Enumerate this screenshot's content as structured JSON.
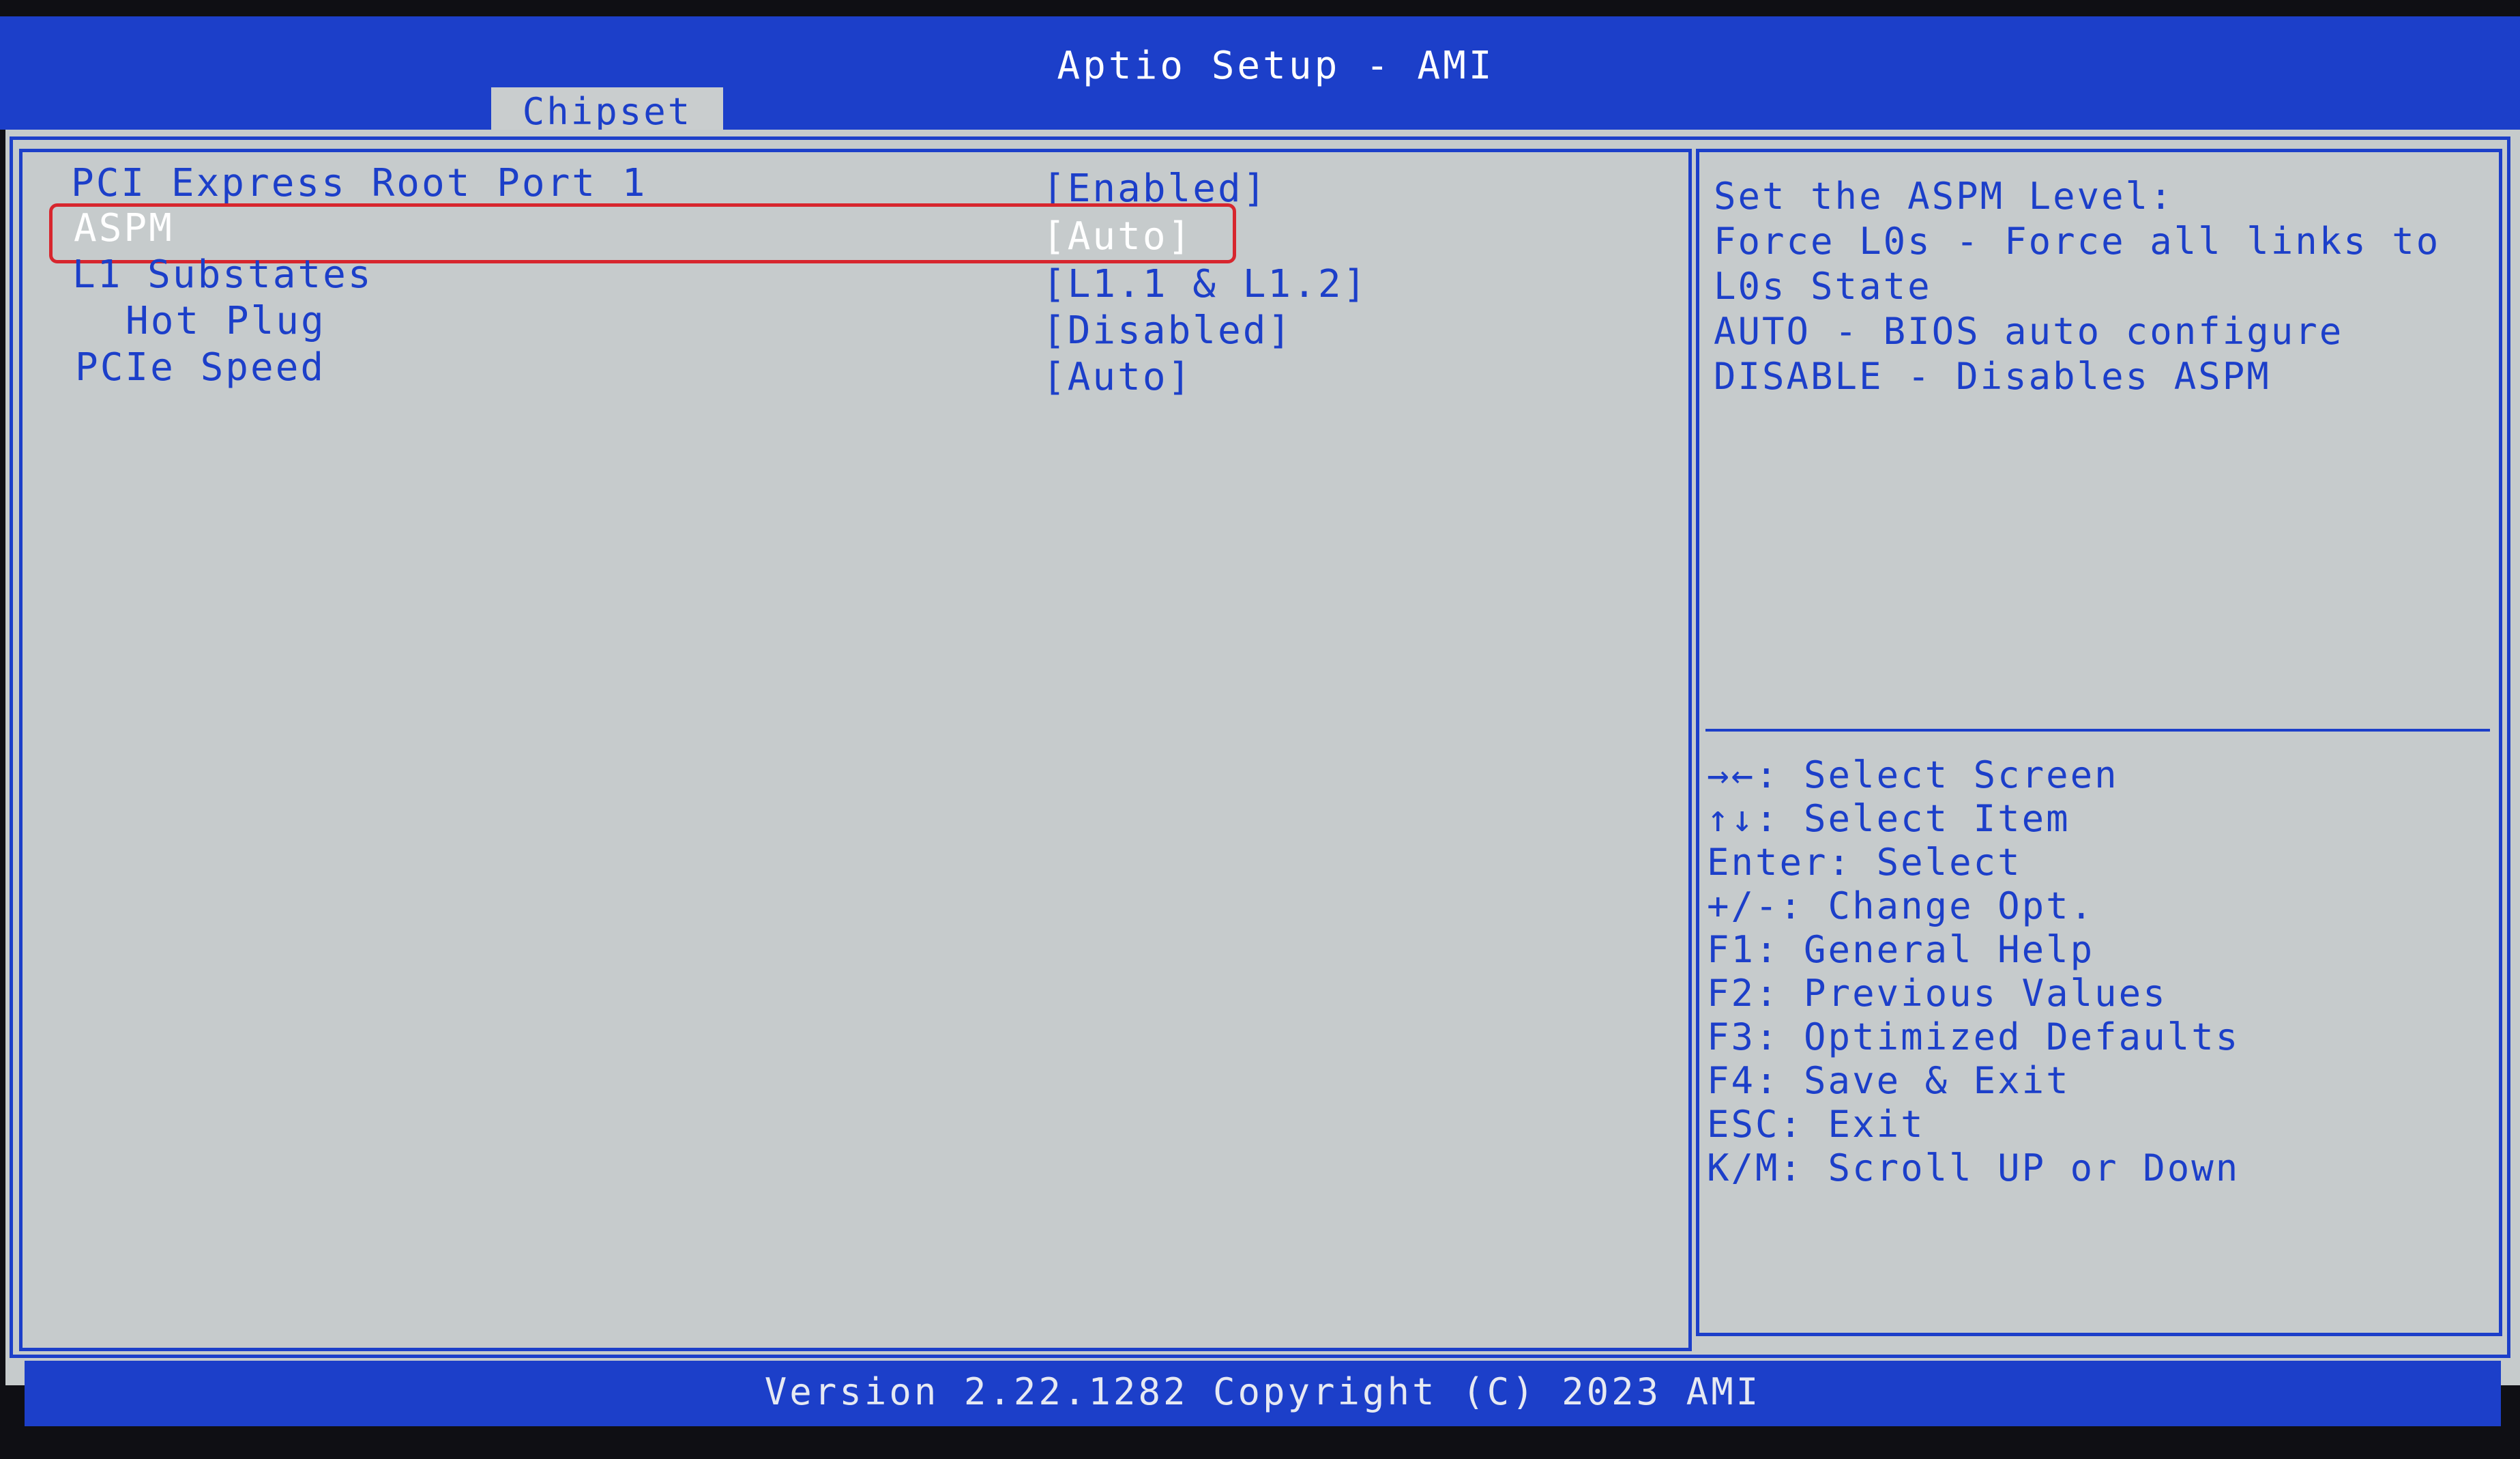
{
  "header": {
    "title": "Aptio Setup - AMI",
    "active_tab": "Chipset"
  },
  "menu": {
    "items": [
      {
        "label": "PCI Express Root Port 1",
        "value": "[Enabled]"
      },
      {
        "label": "ASPM",
        "value": "[Auto]"
      },
      {
        "label": "L1 Substates",
        "value": "[L1.1 & L1.2]"
      },
      {
        "label": "Hot Plug",
        "value": "[Disabled]"
      },
      {
        "label": "PCIe Speed",
        "value": "[Auto]"
      }
    ],
    "selected_label": "ASPM"
  },
  "help": {
    "lines": [
      "Set the ASPM Level:",
      "Force L0s - Force all links to",
      "L0s State",
      "AUTO - BIOS auto configure",
      "DISABLE - Disables ASPM"
    ]
  },
  "keys": [
    "→←: Select Screen",
    "↑↓: Select Item",
    "Enter: Select",
    "+/-: Change Opt.",
    "F1: General Help",
    "F2: Previous Values",
    "F3: Optimized Defaults",
    "F4: Save & Exit",
    "ESC: Exit",
    "K/M: Scroll UP or Down"
  ],
  "footer": {
    "text": "Version 2.22.1282 Copyright (C) 2023 AMI"
  },
  "colors": {
    "bios_blue": "#1c3fc9",
    "panel_grey": "#c6cbcc",
    "highlight_red": "#d7262e",
    "selected_text": "#ffffff"
  }
}
